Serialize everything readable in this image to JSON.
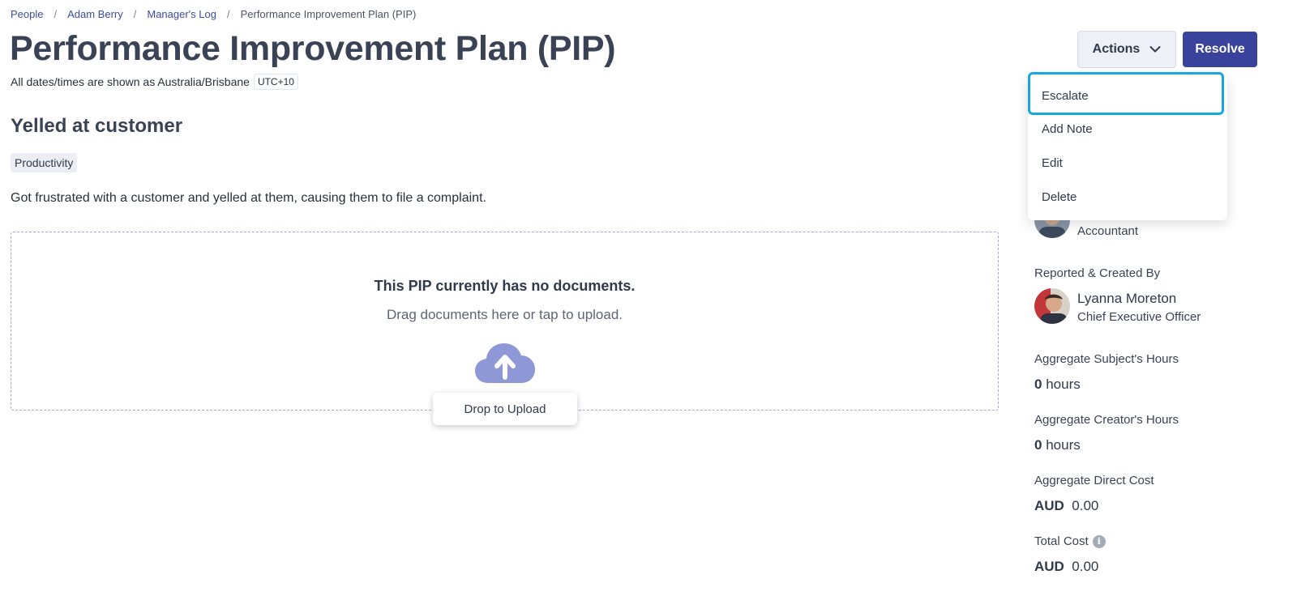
{
  "breadcrumb": {
    "items": [
      "People",
      "Adam Berry",
      "Manager's Log"
    ],
    "current": "Performance Improvement Plan (PIP)",
    "separator": "/"
  },
  "page": {
    "title": "Performance Improvement Plan (PIP)",
    "timezone_text": "All dates/times are shown as Australia/Brisbane",
    "timezone_badge": "UTC+10"
  },
  "incident": {
    "title": "Yelled at customer",
    "tag": "Productivity",
    "description": "Got frustrated with a customer and yelled at them, causing them to file a complaint."
  },
  "documents": {
    "empty_title": "This PIP currently has no documents.",
    "empty_subtitle": "Drag documents here or tap to upload.",
    "drop_button": "Drop to Upload"
  },
  "toolbar": {
    "actions_label": "Actions",
    "resolve_label": "Resolve"
  },
  "actions_menu": {
    "items": [
      "Escalate",
      "Add Note",
      "Edit",
      "Delete"
    ]
  },
  "sidebar": {
    "subject_role": "Accountant",
    "reported_label": "Reported & Created By",
    "reporter_name": "Lyanna Moreton",
    "reporter_role": "Chief Executive Officer",
    "subject_hours_label": "Aggregate Subject's Hours",
    "subject_hours_value": "0",
    "subject_hours_unit": "hours",
    "creator_hours_label": "Aggregate Creator's Hours",
    "creator_hours_value": "0",
    "creator_hours_unit": "hours",
    "direct_cost_label": "Aggregate Direct Cost",
    "direct_cost_currency": "AUD",
    "direct_cost_value": "0.00",
    "total_cost_label": "Total Cost",
    "total_cost_currency": "AUD",
    "total_cost_value": "0.00"
  },
  "colors": {
    "primary": "#3a439c",
    "link": "#3b4ba0",
    "focus_ring": "#1aa6e0",
    "upload_icon": "#8e98d6"
  }
}
